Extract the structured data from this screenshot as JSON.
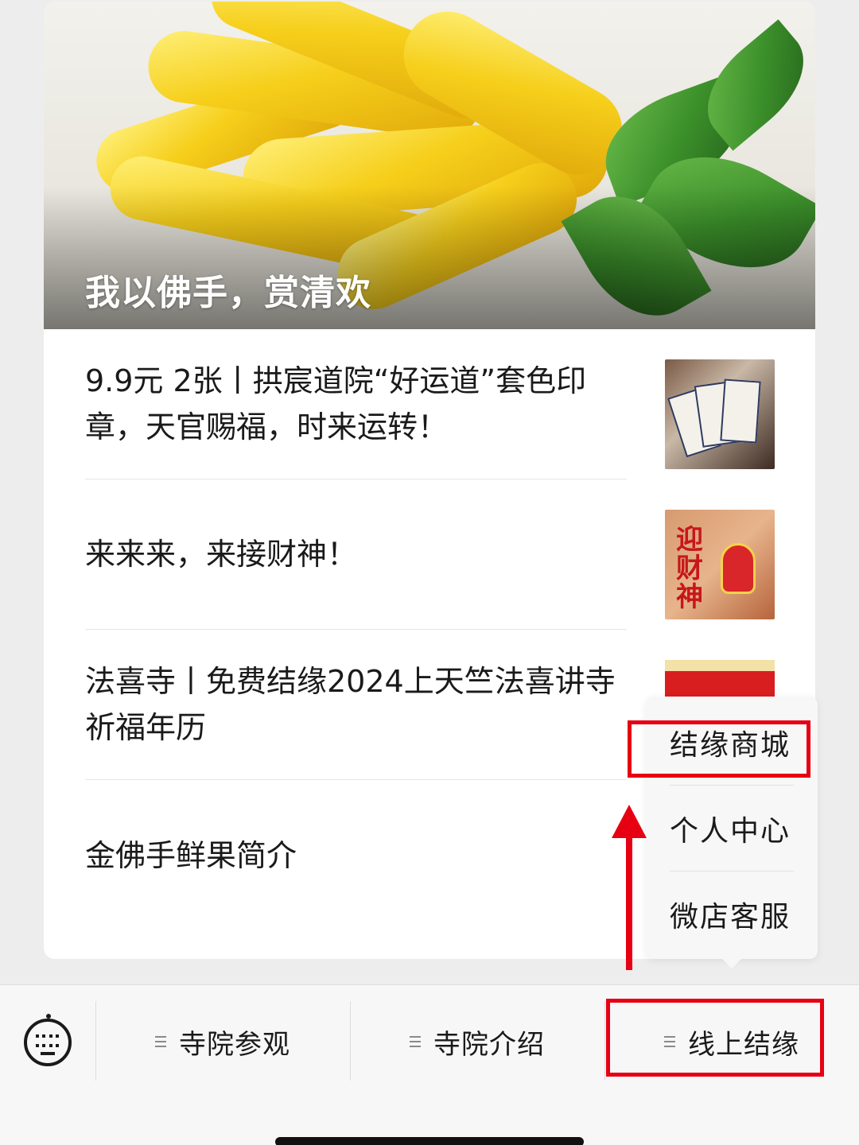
{
  "hero": {
    "title": "我以佛手，赏清欢"
  },
  "articles": [
    {
      "title": "9.9元 2张丨拱宸道院“好运道”套色印章，天官赐福，时来运转！",
      "thumb": "seal-cards-photo"
    },
    {
      "title": "来来来，来接财神！",
      "thumb": "caishen-figure-photo",
      "thumb_text": "迎财神"
    },
    {
      "title": "法喜寺丨免费结缘2024上天竺法喜讲寺祈福年历",
      "thumb": "red-calendar-photo"
    },
    {
      "title": "金佛手鲜果简介"
    }
  ],
  "popup_menu": {
    "items": [
      "结缘商城",
      "个人中心",
      "微店客服"
    ]
  },
  "menubar": {
    "keyboard_icon": "keyboard-icon",
    "tabs": [
      "寺院参观",
      "寺院介绍",
      "线上结缘"
    ]
  },
  "colors": {
    "highlight": "#e60012",
    "background": "#ededed",
    "card": "#ffffff"
  }
}
